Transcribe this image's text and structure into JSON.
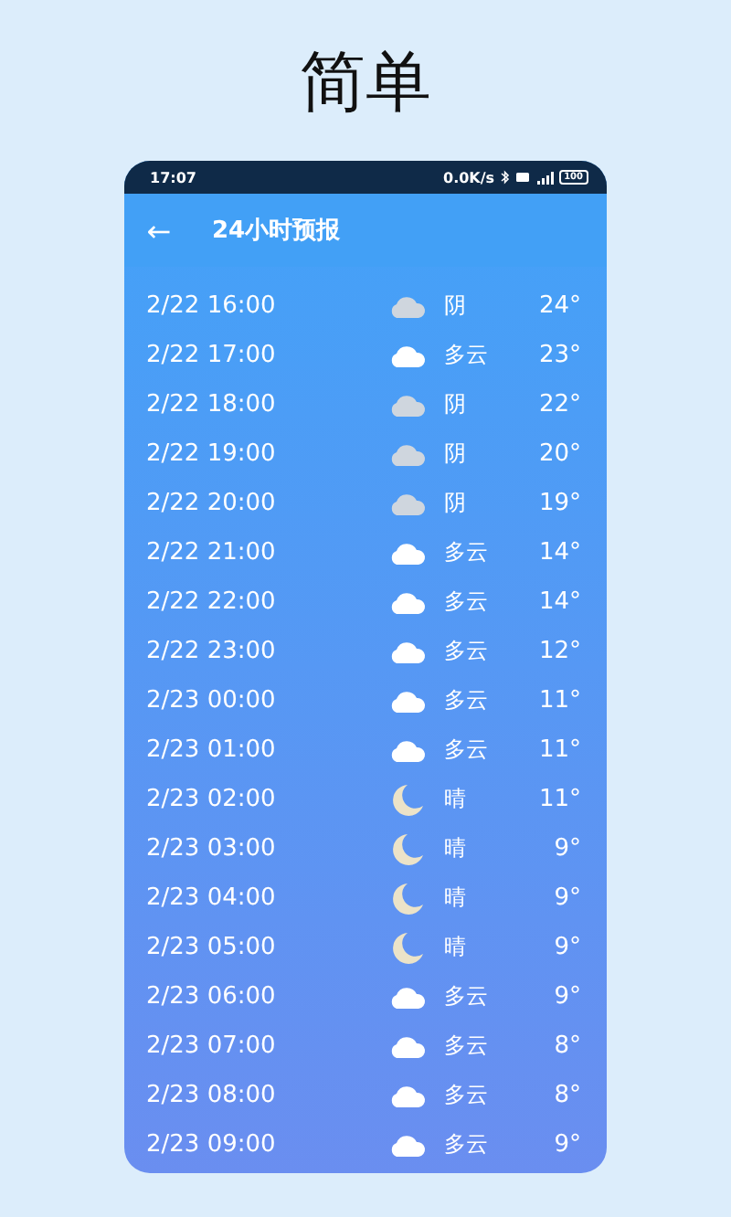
{
  "page_title": "简单",
  "status_bar": {
    "time": "17:07",
    "speed": "0.0K/s",
    "battery": "100"
  },
  "header": {
    "back": "←",
    "title": "24小时预报"
  },
  "rows": [
    {
      "time": "2/22 16:00",
      "kind": "overcast",
      "weather": "阴",
      "temp": "24°"
    },
    {
      "time": "2/22 17:00",
      "kind": "cloudy",
      "weather": "多云",
      "temp": "23°"
    },
    {
      "time": "2/22 18:00",
      "kind": "overcast",
      "weather": "阴",
      "temp": "22°"
    },
    {
      "time": "2/22 19:00",
      "kind": "overcast",
      "weather": "阴",
      "temp": "20°"
    },
    {
      "time": "2/22 20:00",
      "kind": "overcast",
      "weather": "阴",
      "temp": "19°"
    },
    {
      "time": "2/22 21:00",
      "kind": "cloudy",
      "weather": "多云",
      "temp": "14°"
    },
    {
      "time": "2/22 22:00",
      "kind": "cloudy",
      "weather": "多云",
      "temp": "14°"
    },
    {
      "time": "2/22 23:00",
      "kind": "cloudy",
      "weather": "多云",
      "temp": "12°"
    },
    {
      "time": "2/23 00:00",
      "kind": "cloudy",
      "weather": "多云",
      "temp": "11°"
    },
    {
      "time": "2/23 01:00",
      "kind": "cloudy",
      "weather": "多云",
      "temp": "11°"
    },
    {
      "time": "2/23 02:00",
      "kind": "clear-night",
      "weather": "晴",
      "temp": "11°"
    },
    {
      "time": "2/23 03:00",
      "kind": "clear-night",
      "weather": "晴",
      "temp": "9°"
    },
    {
      "time": "2/23 04:00",
      "kind": "clear-night",
      "weather": "晴",
      "temp": "9°"
    },
    {
      "time": "2/23 05:00",
      "kind": "clear-night",
      "weather": "晴",
      "temp": "9°"
    },
    {
      "time": "2/23 06:00",
      "kind": "cloudy",
      "weather": "多云",
      "temp": "9°"
    },
    {
      "time": "2/23 07:00",
      "kind": "cloudy",
      "weather": "多云",
      "temp": "8°"
    },
    {
      "time": "2/23 08:00",
      "kind": "cloudy",
      "weather": "多云",
      "temp": "8°"
    },
    {
      "time": "2/23 09:00",
      "kind": "cloudy",
      "weather": "多云",
      "temp": "9°"
    }
  ]
}
